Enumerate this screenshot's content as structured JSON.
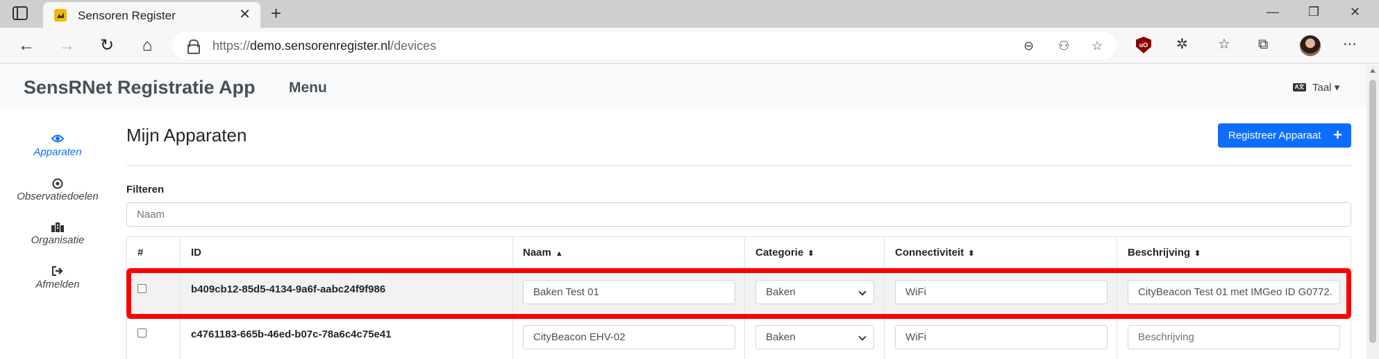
{
  "browser": {
    "tab_title": "Sensoren Register",
    "url_prefix": "https://",
    "url_host": "demo.sensorenregister.nl",
    "url_path": "/devices"
  },
  "app": {
    "brand": "SensRNet Registratie App",
    "menu_label": "Menu",
    "language_label": "Taal"
  },
  "sidebar": {
    "items": [
      {
        "label": "Apparaten",
        "icon": "eye-icon",
        "active": true
      },
      {
        "label": "Observatiedoelen",
        "icon": "target-icon",
        "active": false
      },
      {
        "label": "Organisatie",
        "icon": "building-icon",
        "active": false
      },
      {
        "label": "Afmelden",
        "icon": "sign-out-icon",
        "active": false
      }
    ]
  },
  "main": {
    "title": "Mijn Apparaten",
    "register_button": "Registreer Apparaat",
    "filter_label": "Filteren",
    "filter_placeholder": "Naam"
  },
  "table": {
    "headers": [
      "#",
      "ID",
      "Naam",
      "Categorie",
      "Connectiviteit",
      "Beschrijving"
    ],
    "rows": [
      {
        "id": "b409cb12-85d5-4134-9a6f-aabc24f9f986",
        "name": "Baken Test 01",
        "category": "Baken",
        "connectivity": "WiFi",
        "description": "CityBeacon Test 01 met IMGeo ID G0772.",
        "highlighted": true
      },
      {
        "id": "c4761183-665b-46ed-b07c-78a6c4c75e41",
        "name": "CityBeacon EHV-02",
        "category": "Baken",
        "connectivity": "WiFi",
        "description_placeholder": "Beschrijving",
        "highlighted": false
      }
    ]
  },
  "colors": {
    "accent": "#0d6efd",
    "highlight_border": "#ff0000"
  }
}
